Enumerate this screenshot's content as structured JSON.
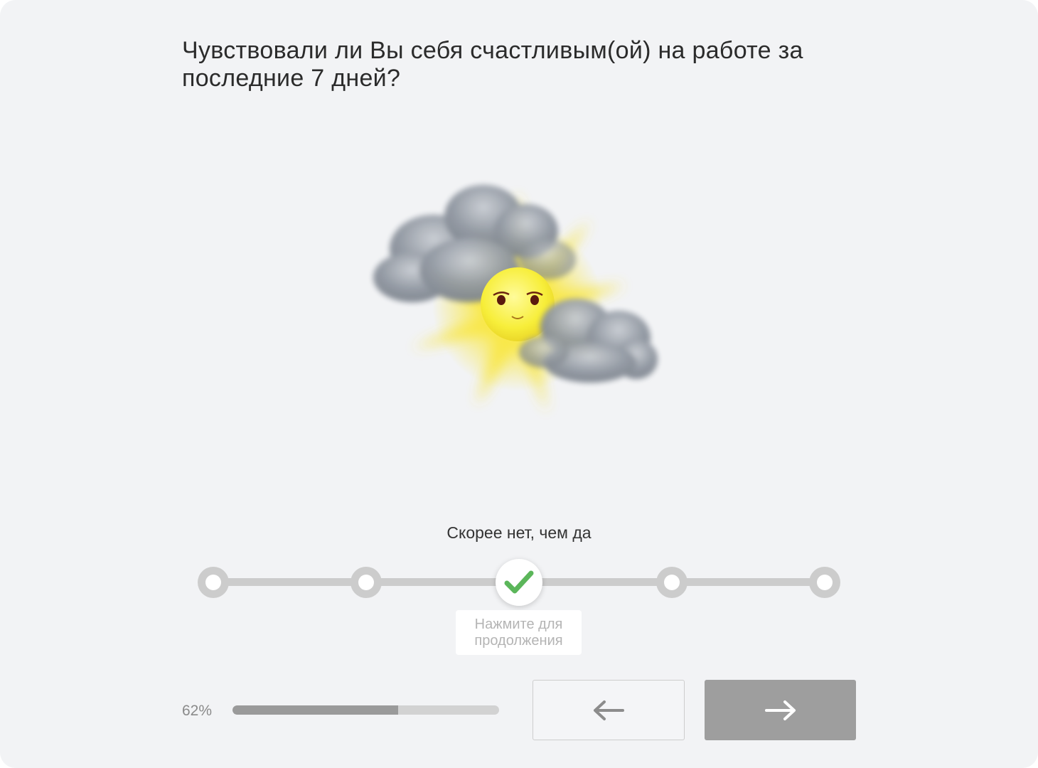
{
  "question": {
    "text": "Чувствовали ли Вы себя счастливым(ой) на работе за последние 7 дней?"
  },
  "illustration": {
    "icon": "sun-behind-clouds-icon",
    "sun_color": "#f7e53a",
    "cloud_color": "#8f96a0"
  },
  "scale": {
    "selected_label": "Скорее нет, чем да",
    "points_count": 5,
    "selected_index": 2,
    "check_color": "#5bb65a",
    "track_color": "#cccccc",
    "hint_text": "Нажмите для продолжения"
  },
  "progress": {
    "label": "62%",
    "fraction": 0.62,
    "fill_color": "#9a9a9a"
  },
  "navigation": {
    "back_icon": "arrow-left-icon",
    "next_icon": "arrow-right-icon",
    "next_color": "#9e9e9e"
  }
}
